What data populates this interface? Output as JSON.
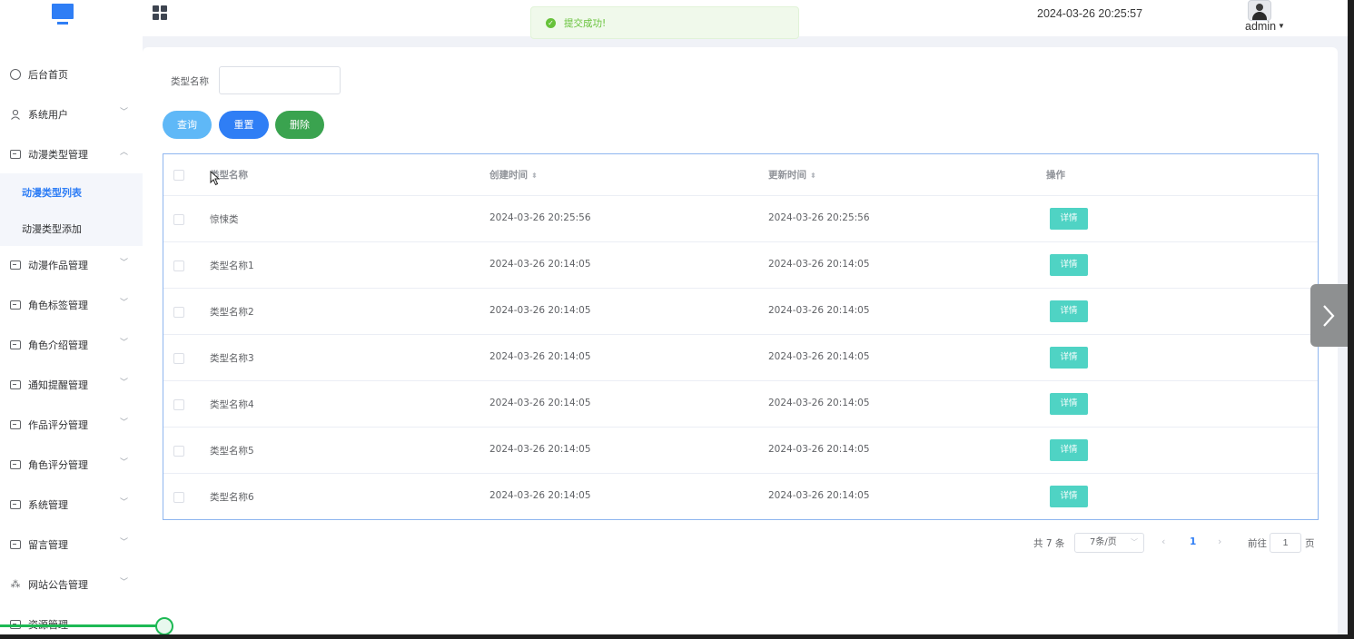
{
  "header": {
    "datetime": "2024-03-26 20:25:57",
    "user": "admin",
    "logo_icon": "monitor-icon",
    "menu_icon": "grid-icon"
  },
  "toast": {
    "message": "提交成功!",
    "color": "#67c23a"
  },
  "sidebar": {
    "items": [
      {
        "label": "后台首页",
        "icon": "clock-icon"
      },
      {
        "label": "系统用户",
        "icon": "user-icon"
      },
      {
        "label": "动漫类型管理",
        "icon": "card-icon"
      },
      {
        "label": "动漫作品管理",
        "icon": "card-icon"
      },
      {
        "label": "角色标签管理",
        "icon": "card-icon"
      },
      {
        "label": "角色介绍管理",
        "icon": "card-icon"
      },
      {
        "label": "通知提醒管理",
        "icon": "card-icon"
      },
      {
        "label": "作品评分管理",
        "icon": "card-icon"
      },
      {
        "label": "角色评分管理",
        "icon": "card-icon"
      },
      {
        "label": "系统管理",
        "icon": "folder-icon"
      },
      {
        "label": "留言管理",
        "icon": "folder-icon"
      },
      {
        "label": "网站公告管理",
        "icon": "loading-icon"
      },
      {
        "label": "资源管理",
        "icon": "card-icon"
      }
    ],
    "sub_items": [
      {
        "label": "动漫类型列表"
      },
      {
        "label": "动漫类型添加"
      }
    ]
  },
  "search": {
    "label": "类型名称",
    "value": "",
    "query_label": "查询",
    "reset_label": "重置",
    "delete_label": "删除"
  },
  "table": {
    "columns": [
      "类型名称",
      "创建时间",
      "更新时间",
      "操作"
    ],
    "detail_label": "详情",
    "rows": [
      {
        "name": "惊悚类",
        "created": "2024-03-26 20:25:56",
        "updated": "2024-03-26 20:25:56"
      },
      {
        "name": "类型名称1",
        "created": "2024-03-26 20:14:05",
        "updated": "2024-03-26 20:14:05"
      },
      {
        "name": "类型名称2",
        "created": "2024-03-26 20:14:05",
        "updated": "2024-03-26 20:14:05"
      },
      {
        "name": "类型名称3",
        "created": "2024-03-26 20:14:05",
        "updated": "2024-03-26 20:14:05"
      },
      {
        "name": "类型名称4",
        "created": "2024-03-26 20:14:05",
        "updated": "2024-03-26 20:14:05"
      },
      {
        "name": "类型名称5",
        "created": "2024-03-26 20:14:05",
        "updated": "2024-03-26 20:14:05"
      },
      {
        "name": "类型名称6",
        "created": "2024-03-26 20:14:05",
        "updated": "2024-03-26 20:14:05"
      }
    ]
  },
  "pagination": {
    "total": "共 7 条",
    "page_size": "7条/页",
    "current_page": "1",
    "goto_label": "前往",
    "goto_value": "1",
    "page_unit": "页"
  },
  "colors": {
    "primary": "#2f7ef5",
    "query": "#5fb8f7",
    "delete": "#3aa34f",
    "detail": "#4fd3c4",
    "progress": "#1db954"
  }
}
